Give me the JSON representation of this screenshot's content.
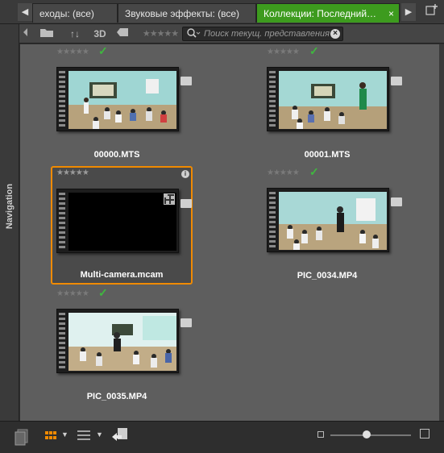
{
  "tabs": [
    {
      "label": "Переходы: (все)",
      "visible_label": "еходы: (все)"
    },
    {
      "label": "Звуковые эффекты: (все)"
    },
    {
      "label": "Коллекции: Последний…",
      "active": true,
      "close": "×"
    }
  ],
  "toolbar": {
    "search_placeholder": "Поиск текущ. представления",
    "three_d_label": "3D",
    "sort_label": "↑↓"
  },
  "navigation": {
    "label": "Navigation"
  },
  "items": [
    {
      "name": "00000.MTS",
      "rating": "★★★★★",
      "checked": true
    },
    {
      "name": "00001.MTS",
      "rating": "★★★★★",
      "checked": true
    },
    {
      "name": "Multi-camera.mcam",
      "rating": "★★★★★",
      "checked": false,
      "selected": true
    },
    {
      "name": "PIC_0034.MP4",
      "rating": "★★★★★",
      "checked": true
    },
    {
      "name": "PIC_0035.MP4",
      "rating": "★★★★★",
      "checked": true
    }
  ],
  "zoom": {
    "level": 0.45
  },
  "colors": {
    "accent": "#f08a00",
    "active_tab": "#3d9b1e",
    "check": "#3fb83f"
  },
  "icons": [
    "arrow-left-icon",
    "arrow-right-icon",
    "folder-icon",
    "sort-icon",
    "tag-icon",
    "search-icon",
    "clear-icon",
    "grid-view-icon",
    "list-view-icon",
    "import-icon",
    "pages-icon",
    "add-tab-icon",
    "info-icon",
    "multicam-icon"
  ]
}
